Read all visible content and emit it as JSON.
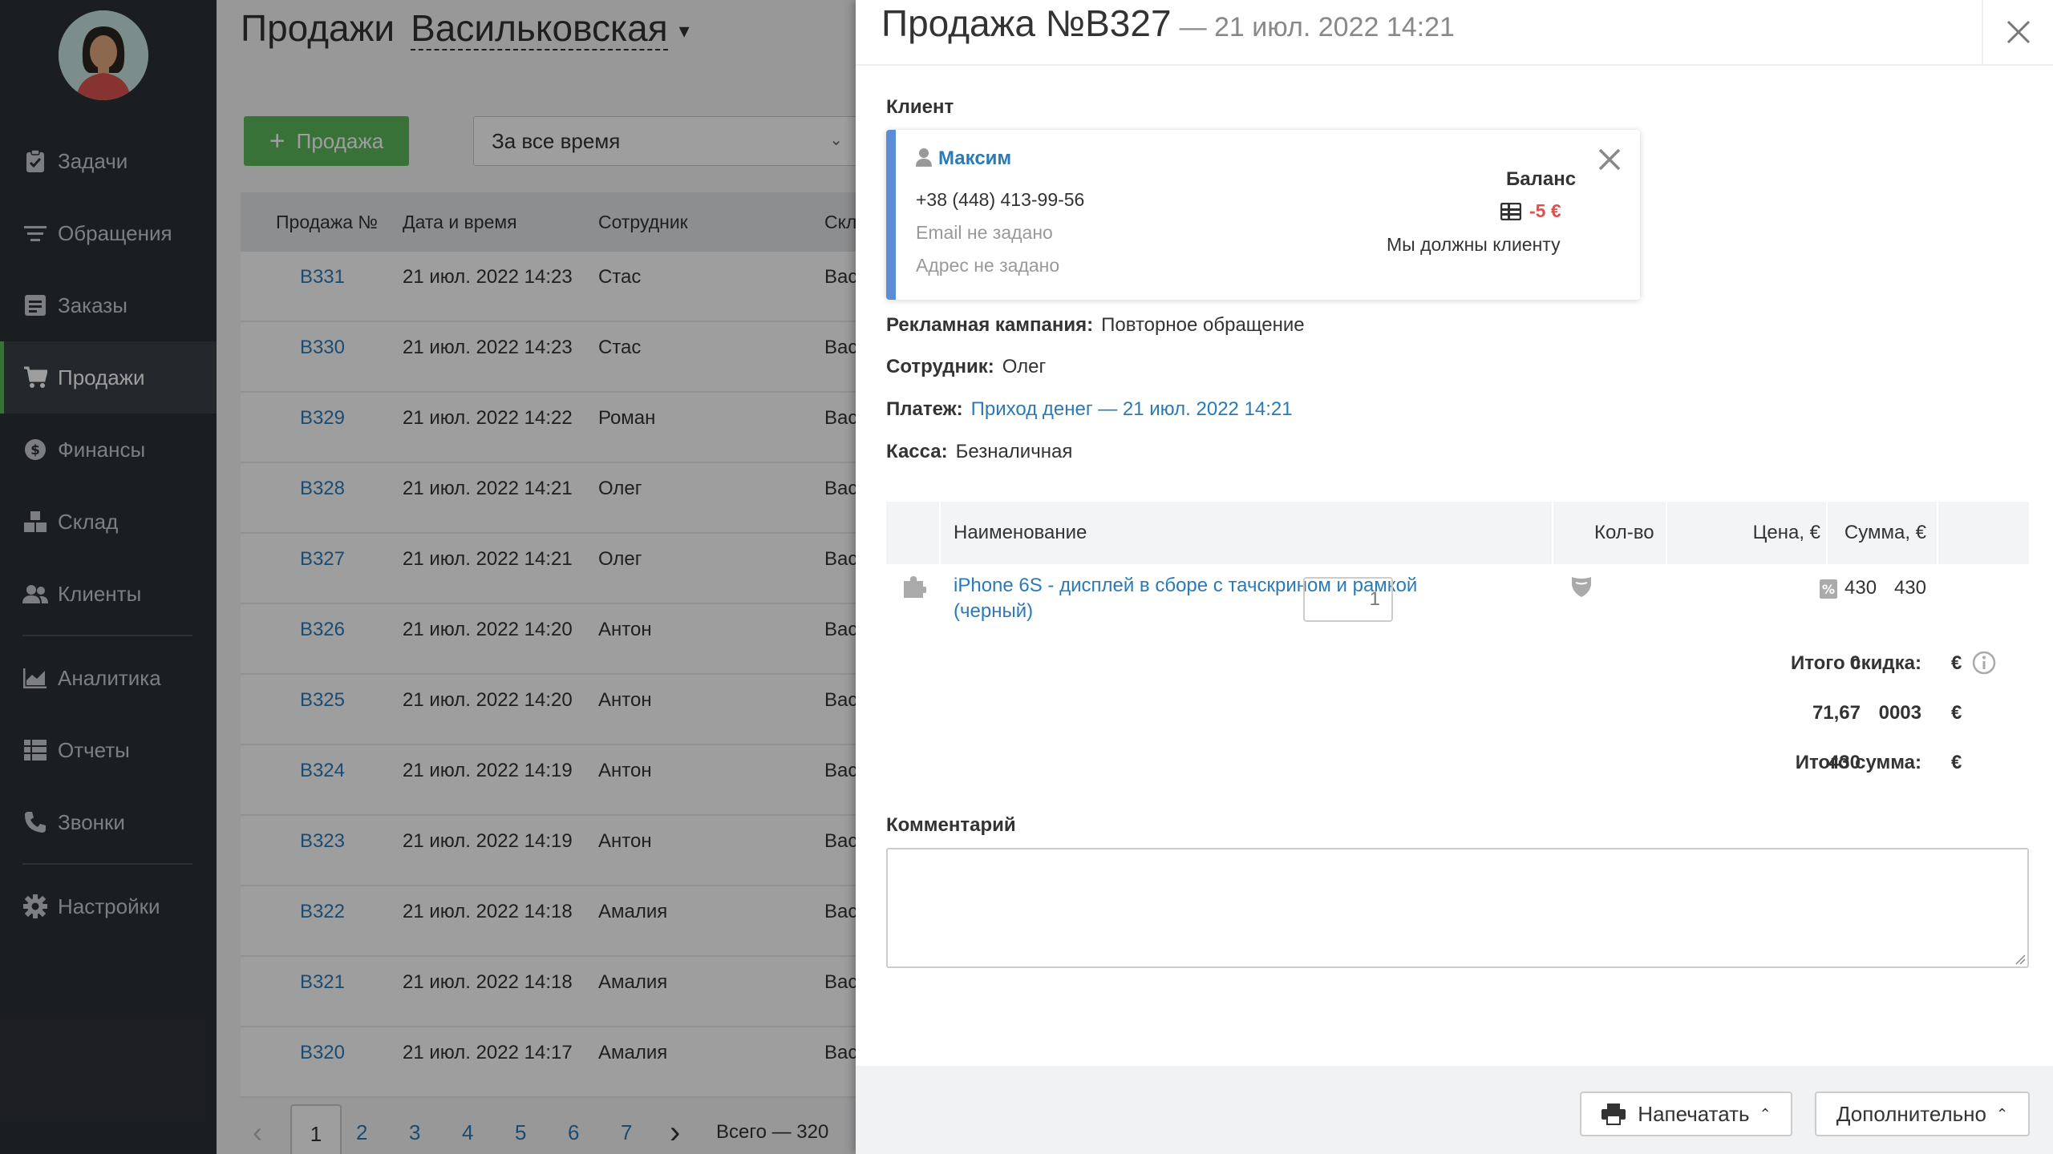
{
  "sidebar": {
    "items": [
      {
        "label": "Задачи"
      },
      {
        "label": "Обращения"
      },
      {
        "label": "Заказы"
      },
      {
        "label": "Продажи"
      },
      {
        "label": "Финансы"
      },
      {
        "label": "Склад"
      },
      {
        "label": "Клиенты"
      },
      {
        "label": "Аналитика"
      },
      {
        "label": "Отчеты"
      },
      {
        "label": "Звонки"
      },
      {
        "label": "Настройки"
      }
    ]
  },
  "main": {
    "title": "Продажи",
    "store": "Васильковская",
    "add_button": "Продажа",
    "period": "За все время",
    "columns": [
      "Продажа №",
      "Дата и время",
      "Сотрудник",
      "Скл"
    ],
    "rows": [
      {
        "num": "B331",
        "date": "21 июл. 2022 14:23",
        "employee": "Стас",
        "store": "Вас"
      },
      {
        "num": "B330",
        "date": "21 июл. 2022 14:23",
        "employee": "Стас",
        "store": "Вас"
      },
      {
        "num": "B329",
        "date": "21 июл. 2022 14:22",
        "employee": "Роман",
        "store": "Вас"
      },
      {
        "num": "B328",
        "date": "21 июл. 2022 14:21",
        "employee": "Олег",
        "store": "Вас"
      },
      {
        "num": "B327",
        "date": "21 июл. 2022 14:21",
        "employee": "Олег",
        "store": "Вас"
      },
      {
        "num": "B326",
        "date": "21 июл. 2022 14:20",
        "employee": "Антон",
        "store": "Вас"
      },
      {
        "num": "B325",
        "date": "21 июл. 2022 14:20",
        "employee": "Антон",
        "store": "Вас"
      },
      {
        "num": "B324",
        "date": "21 июл. 2022 14:19",
        "employee": "Антон",
        "store": "Вас"
      },
      {
        "num": "B323",
        "date": "21 июл. 2022 14:19",
        "employee": "Антон",
        "store": "Вас"
      },
      {
        "num": "B322",
        "date": "21 июл. 2022 14:18",
        "employee": "Амалия",
        "store": "Вас"
      },
      {
        "num": "B321",
        "date": "21 июл. 2022 14:18",
        "employee": "Амалия",
        "store": "Вас"
      },
      {
        "num": "B320",
        "date": "21 июл. 2022 14:17",
        "employee": "Амалия",
        "store": "Вас"
      }
    ],
    "pager": {
      "pages": [
        "1",
        "2",
        "3",
        "4",
        "5",
        "6",
        "7"
      ],
      "total": "Всего — 320"
    }
  },
  "panel": {
    "title": "Продажа №B327",
    "subtitle": "— 21 июл. 2022 14:21",
    "client_label": "Клиент",
    "client": {
      "name": "Максим",
      "phone": "+38 (448) 413-99-56",
      "email": "Email не задано",
      "address": "Адрес не задано",
      "balance_label": "Баланс",
      "balance_value": "-5 €",
      "balance_note": "Мы должны клиенту"
    },
    "fields": {
      "campaign_k": "Рекламная кампания:",
      "campaign_v": "Повторное обращение",
      "employee_k": "Сотрудник:",
      "employee_v": "Олег",
      "payment_k": "Платеж:",
      "payment_v": "Приход денег — 21 июл. 2022 14:21",
      "cash_k": "Касса:",
      "cash_v": "Безналичная"
    },
    "items": {
      "columns": {
        "name": "Наименование",
        "qty": "Кол-во",
        "price": "Цена, €",
        "sum": "Сумма, €"
      },
      "rows": [
        {
          "name_line1": "iPhone 6S - дисплей в сборе с тачскрином и рамкой",
          "name_line2": "(черный)",
          "qty": "1",
          "price": "430",
          "sum": "430"
        }
      ]
    },
    "totals": {
      "discount_label": "Итого скидка:",
      "discount_value": "0",
      "discount_cur": "€",
      "tax_label": "0003",
      "tax_value": "71,67",
      "tax_cur": "€",
      "sum_label": "Итого сумма:",
      "sum_value": "430",
      "sum_cur": "€"
    },
    "comment_label": "Комментарий",
    "footer": {
      "print": "Напечатать",
      "more": "Дополнительно"
    }
  },
  "colors": {
    "accent_green": "#5cb85c",
    "link_blue": "#2a7ab8",
    "card_border_blue": "#5b8dd6",
    "debt_red": "#d9534f",
    "sidebar_bg": "#2d3136"
  }
}
